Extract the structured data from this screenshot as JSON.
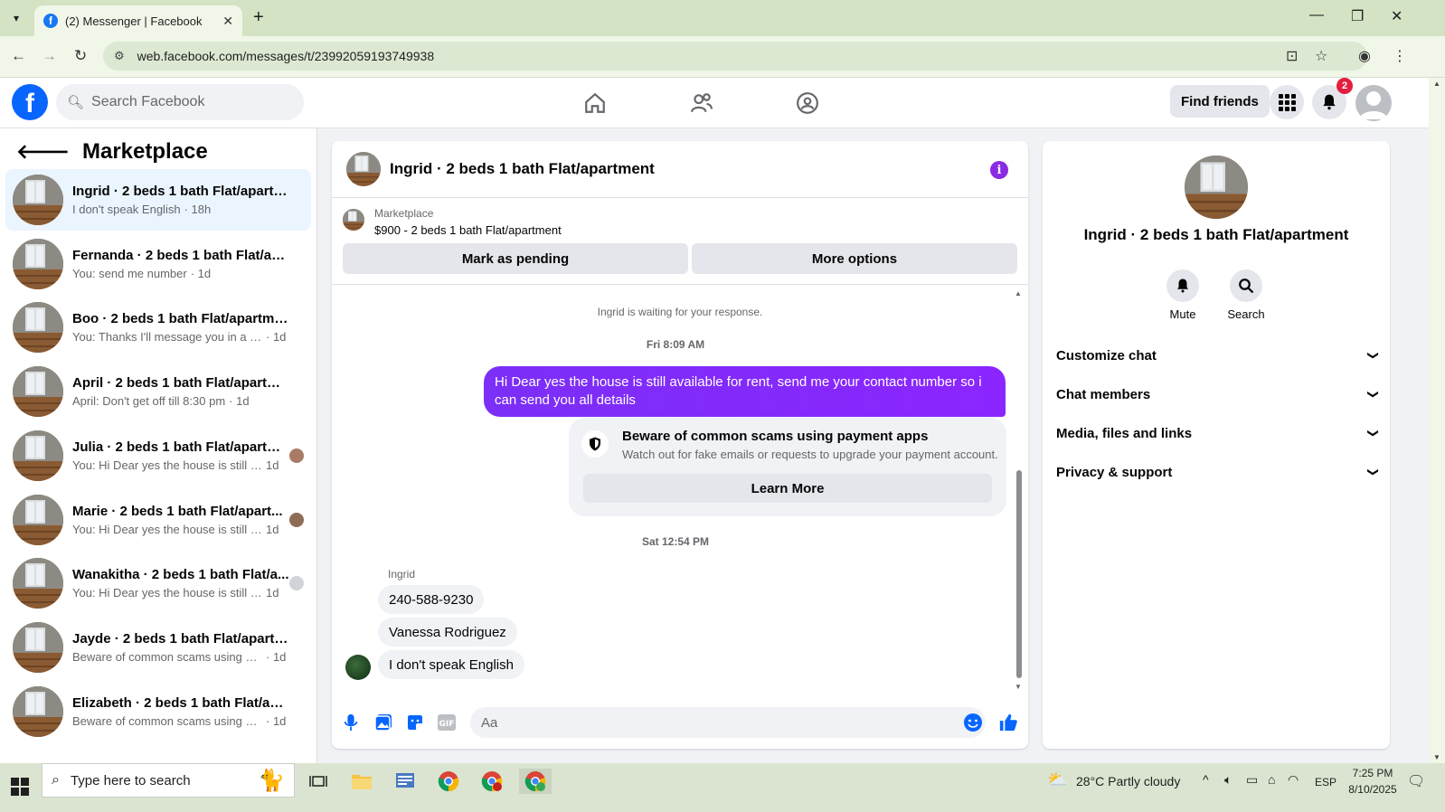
{
  "browser": {
    "tab_title": "(2) Messenger | Facebook",
    "url": "web.facebook.com/messages/t/23992059193749938"
  },
  "header": {
    "search_placeholder": "Search Facebook",
    "find_friends": "Find friends",
    "notification_count": "2"
  },
  "sidebar": {
    "title": "Marketplace",
    "conversations": [
      {
        "name": "Ingrid · 2 beds 1 bath Flat/apartme...",
        "snippet": "I don't speak English",
        "time": "· 18h"
      },
      {
        "name": "Fernanda · 2 beds 1 bath Flat/apar...",
        "snippet": "You: send me number",
        "time": "· 1d"
      },
      {
        "name": "Boo · 2 beds 1 bath Flat/apartment",
        "snippet": "You: Thanks I'll message you in a mo...",
        "time": "· 1d"
      },
      {
        "name": "April · 2 beds 1 bath Flat/apartment",
        "snippet": "April: Don't get off till 8:30 pm",
        "time": "· 1d"
      },
      {
        "name": "Julia · 2 beds 1 bath Flat/apartm...",
        "snippet": "You: Hi Dear yes the house is still a...",
        "time": "1d"
      },
      {
        "name": "Marie · 2 beds 1 bath Flat/apart...",
        "snippet": "You: Hi Dear yes the house is still a...",
        "time": "1d"
      },
      {
        "name": "Wanakitha · 2 beds 1 bath Flat/a...",
        "snippet": "You: Hi Dear yes the house is still a...",
        "time": "1d"
      },
      {
        "name": "Jayde · 2 beds 1 bath Flat/apartment",
        "snippet": "Beware of common scams using pay...",
        "time": "· 1d"
      },
      {
        "name": "Elizabeth · 2 beds 1 bath Flat/apart...",
        "snippet": "Beware of common scams using pay...",
        "time": "· 1d"
      }
    ]
  },
  "chat": {
    "title": "Ingrid · 2 beds 1 bath Flat/apartment",
    "marketplace_label": "Marketplace",
    "listing": "$900 - 2 beds 1 bath Flat/apartment",
    "mark_pending": "Mark as pending",
    "more_options": "More options",
    "waiting_text": "Ingrid is waiting for your response.",
    "timestamp_1": "Fri 8:09 AM",
    "outgoing_message": "Hi Dear yes the house is still available for rent, send me your contact number so i can send you all details",
    "scam_title": "Beware of common scams using payment apps",
    "scam_subtitle": "Watch out for fake emails or requests to upgrade your payment account.",
    "learn_more": "Learn More",
    "timestamp_2": "Sat 12:54 PM",
    "sender_name": "Ingrid",
    "incoming": [
      "240-588-9230",
      "Vanessa Rodriguez",
      "I don't speak English"
    ],
    "composer_placeholder": "Aa"
  },
  "info_panel": {
    "name": "Ingrid · 2 beds 1 bath Flat/apartment",
    "mute": "Mute",
    "search": "Search",
    "rows": [
      "Customize chat",
      "Chat members",
      "Media, files and links",
      "Privacy & support"
    ]
  },
  "taskbar": {
    "search_placeholder": "Type here to search",
    "weather": "28°C  Partly cloudy",
    "lang": "ESP",
    "time": "7:25 PM",
    "date": "8/10/2025"
  },
  "colors": {
    "brand_blue": "#0866ff",
    "outgoing_purple": "#7b2ff7",
    "active_row": "#ebf5ff"
  }
}
